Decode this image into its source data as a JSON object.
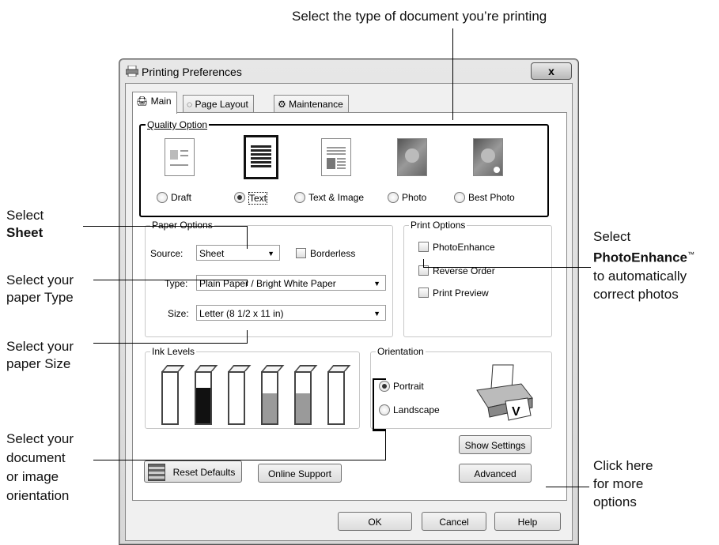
{
  "callouts": {
    "top": "Select the type of document you’re printing",
    "sheet_1": "Select",
    "sheet_2": "Sheet",
    "type_1": "Select your",
    "type_2": "paper Type",
    "size_1": "Select your",
    "size_2": "paper Size",
    "orient_1": "Select your",
    "orient_2": "document",
    "orient_3": "or image",
    "orient_4": "orientation",
    "photo_1": "Select",
    "photo_2": "PhotoEnhance",
    "photo_tm": "™",
    "photo_3": "to automatically",
    "photo_4": "correct photos",
    "adv_1": "Click here",
    "adv_2": "for more",
    "adv_3": "options"
  },
  "window": {
    "title": "Printing Preferences",
    "close": "x"
  },
  "tabs": [
    "Main",
    "Page Layout",
    "Maintenance"
  ],
  "quality": {
    "label": "Quality Option",
    "options": [
      "Draft",
      "Text",
      "Text & Image",
      "Photo",
      "Best Photo"
    ],
    "selected": "Text"
  },
  "paper": {
    "label": "Paper Options",
    "source_label": "Source:",
    "source_value": "Sheet",
    "borderless": "Borderless",
    "type_label": "Type:",
    "type_value": "Plain Paper / Bright White Paper",
    "size_label": "Size:",
    "size_value": "Letter (8 1/2 x 11 in)"
  },
  "print_options": {
    "label": "Print Options",
    "items": [
      "PhotoEnhance",
      "Reverse Order",
      "Print Preview"
    ]
  },
  "ink": {
    "label": "Ink Levels",
    "levels": [
      0.95,
      0.7,
      0.9,
      0.6,
      0.6,
      0.9
    ],
    "colors": [
      "#ffffff",
      "#111111",
      "#ffffff",
      "#9a9a9a",
      "#9a9a9a",
      "#ffffff"
    ]
  },
  "orientation": {
    "label": "Orientation",
    "options": [
      "Portrait",
      "Landscape"
    ],
    "selected": "Portrait"
  },
  "buttons": {
    "show_settings": "Show Settings",
    "reset_defaults": "Reset Defaults",
    "online_support": "Online Support",
    "advanced": "Advanced",
    "ok": "OK",
    "cancel": "Cancel",
    "help": "Help"
  }
}
